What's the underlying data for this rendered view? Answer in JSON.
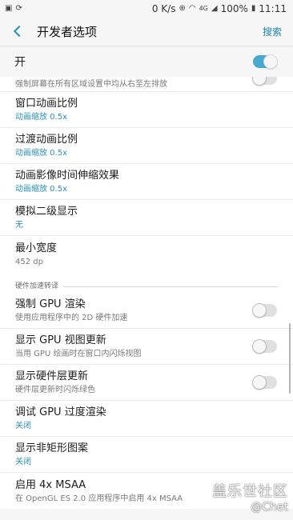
{
  "status_bar": {
    "speed": "0 K/s",
    "network": "4G",
    "battery": "100%",
    "time": "11:11"
  },
  "header": {
    "title": "开发者选项",
    "search_label": "搜索"
  },
  "master_toggle": {
    "label": "开",
    "on": true
  },
  "partial_row": {
    "subtitle": "强制屏幕在所有区域设置中均从右至左排放"
  },
  "rows_top": [
    {
      "title": "窗口动画比例",
      "subtitle": "动画缩放 0.5x"
    },
    {
      "title": "过渡动画比例",
      "subtitle": "动画缩放 0.5x"
    },
    {
      "title": "动画影像时间伸缩效果",
      "subtitle": "动画缩放 0.5x"
    },
    {
      "title": "模拟二级显示",
      "subtitle": "无"
    },
    {
      "title": "最小宽度",
      "subtitle": "452 dp"
    }
  ],
  "section_hw": {
    "label": "硬件加速转译"
  },
  "rows_bottom": [
    {
      "title": "强制 GPU 渲染",
      "subtitle": "使用应用程序中的 2D 硬件加速"
    },
    {
      "title": "显示 GPU 视图更新",
      "subtitle": "当用 GPU 绘画时在窗口内闪烁视图"
    },
    {
      "title": "显示硬件层更新",
      "subtitle": "硬件层更新时闪烁绿色"
    },
    {
      "title": "调试 GPU 过度渲染",
      "subtitle": "关闭"
    },
    {
      "title": "显示非矩形图案",
      "subtitle": "关闭"
    },
    {
      "title": "启用 4x MSAA",
      "subtitle": "在 OpenGL ES 2.0 应用程序中启用 4x MSAA"
    }
  ],
  "watermark": {
    "line1": "盖乐世社区",
    "line2": "@Chet"
  },
  "colors": {
    "accent": "#2a8fb0",
    "toggle_on": "#48a9d1"
  }
}
